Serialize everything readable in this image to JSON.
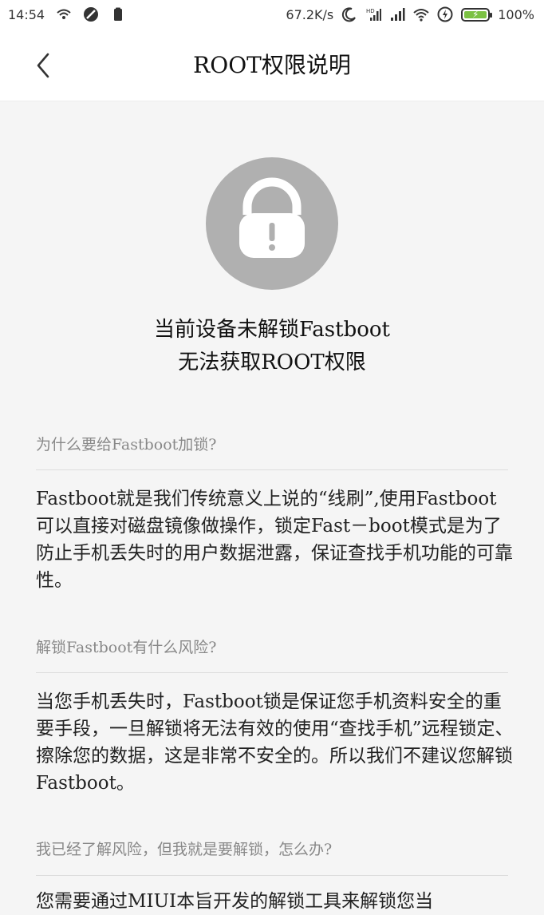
{
  "status_bar": {
    "time": "14:54",
    "net_speed": "67.2K/s",
    "battery_percent": "100%"
  },
  "header": {
    "title": "ROOT权限说明"
  },
  "lock": {
    "icon": "lock-icon",
    "circle_color": "#b0b0b0"
  },
  "message": {
    "line1": "当前设备未解锁Fastboot",
    "line2": "无法获取ROOT权限"
  },
  "sections": [
    {
      "question": "为什么要给Fastboot加锁?",
      "answer": "Fastboot就是我们传统意义上说的“线刷”,使用Fastboot可以直接对磁盘镜像做操作，锁定Fast－boot模式是为了防止手机丢失时的用户数据泄露，保证查找手机功能的可靠性。"
    },
    {
      "question": "解锁Fastboot有什么风险?",
      "answer": "当您手机丢失时，Fastboot锁是保证您手机资料安全的重要手段，一旦解锁将无法有效的使用“查找手机”远程锁定、擦除您的数据，这是非常不安全的。所以我们不建议您解锁Fastboot。"
    },
    {
      "question": "我已经了解风险，但我就是要解锁，怎么办?",
      "answer": "您需要通过MIUI本旨开发的解锁工具来解锁您当"
    }
  ]
}
